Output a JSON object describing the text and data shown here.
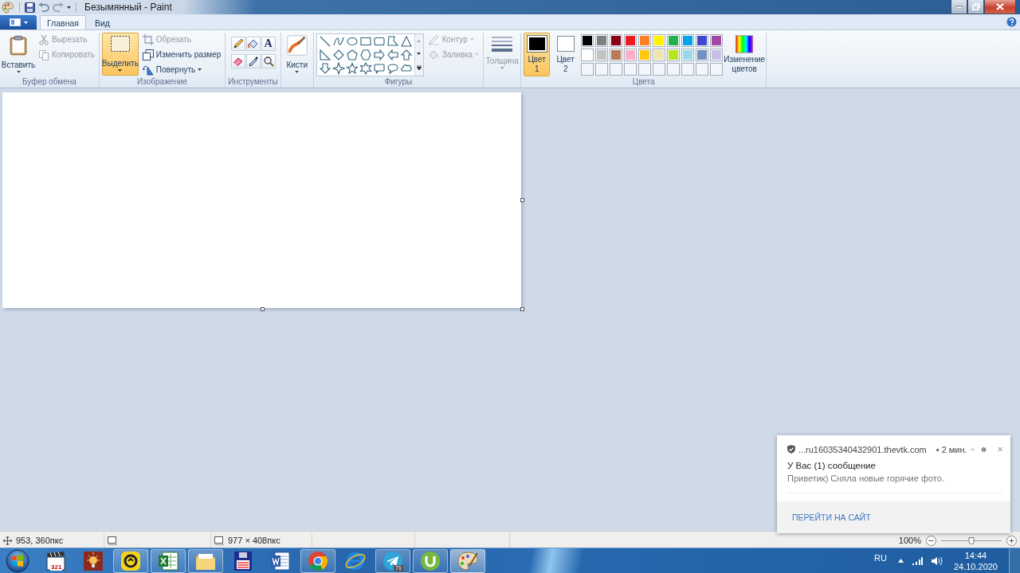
{
  "window": {
    "title": "Безымянный - Paint"
  },
  "tabs": [
    {
      "label": "Главная",
      "selected": true
    },
    {
      "label": "Вид",
      "selected": false
    }
  ],
  "clipboard": {
    "label": "Буфер обмена",
    "paste": "Вставить",
    "actions": [
      {
        "kind": "cut",
        "label": "Вырезать",
        "disabled": true
      },
      {
        "kind": "copy",
        "label": "Копировать",
        "disabled": true
      }
    ]
  },
  "image": {
    "label": "Изображение",
    "select": {
      "label": "Выделить",
      "selected": true
    },
    "actions": [
      {
        "kind": "crop",
        "label": "Обрезать",
        "disabled": true
      },
      {
        "kind": "resize",
        "label": "Изменить размер",
        "disabled": false
      },
      {
        "kind": "rotate",
        "label": "Повернуть",
        "disabled": false
      }
    ]
  },
  "tools": {
    "label": "Инструменты",
    "text_tool": "A"
  },
  "brushes": {
    "label": "Кисти"
  },
  "shapes": {
    "label": "Фигуры",
    "options": [
      {
        "kind": "outline",
        "label": "Контур",
        "disabled": true
      },
      {
        "kind": "fill",
        "label": "Заливка",
        "disabled": true
      }
    ]
  },
  "size": {
    "label": "Толщина",
    "disabled": true
  },
  "colors": {
    "label": "Цвета",
    "slots": [
      {
        "label": "Цвет",
        "number": "1",
        "selected": true,
        "color": "#000000"
      },
      {
        "label": "Цвет",
        "number": "2",
        "selected": false,
        "color": "#ffffff"
      }
    ],
    "palette": [
      {
        "color": "#000000"
      },
      {
        "color": "#7f7f7f"
      },
      {
        "color": "#880015"
      },
      {
        "color": "#ed1c24"
      },
      {
        "color": "#ff7f27"
      },
      {
        "color": "#fff200"
      },
      {
        "color": "#22b14c"
      },
      {
        "color": "#00a2e8"
      },
      {
        "color": "#3f48cc"
      },
      {
        "color": "#a349a4"
      },
      {
        "color": "#ffffff"
      },
      {
        "color": "#c3c3c3"
      },
      {
        "color": "#b97a57"
      },
      {
        "color": "#ffaec9"
      },
      {
        "color": "#ffc90e"
      },
      {
        "color": "#efe4b0"
      },
      {
        "color": "#b5e61d"
      },
      {
        "color": "#99d9ea"
      },
      {
        "color": "#7092be"
      },
      {
        "color": "#c8bfe7"
      }
    ],
    "edit": "Изменение цветов"
  },
  "status_bar": {
    "cursor": "953, 360пкс",
    "size": "977 × 408пкс",
    "zoom": "100%",
    "zoom_slider": {
      "level": 0.5
    }
  },
  "notification": {
    "source": "...ru16035340432901.thevtk.com",
    "time": "• 2 мин.",
    "title": "У Вас (1) сообщение",
    "body": "Приветик) Сняла новые горячие фото.",
    "action": "ПЕРЕЙТИ НА САЙТ"
  },
  "taskbar": {
    "apps": [
      {
        "kind": "media",
        "label": "321",
        "running": false,
        "selected": false
      },
      {
        "kind": "bulb",
        "running": false,
        "selected": false
      },
      {
        "kind": "lightshot",
        "running": true,
        "selected": false
      },
      {
        "kind": "sheet",
        "running": true,
        "selected": false
      },
      {
        "kind": "folder",
        "running": true,
        "selected": false
      },
      {
        "kind": "floppy",
        "running": false,
        "selected": false
      },
      {
        "kind": "document",
        "running": false,
        "selected": false
      },
      {
        "kind": "chrome",
        "running": true,
        "selected": false
      },
      {
        "kind": "ie",
        "running": false,
        "selected": false
      },
      {
        "kind": "telegram",
        "badge": "71",
        "running": true,
        "selected": false
      },
      {
        "kind": "torrent",
        "running": true,
        "selected": false
      },
      {
        "kind": "paint",
        "running": true,
        "selected": true
      }
    ],
    "language": "RU",
    "time": "14:44",
    "date": "24.10.2020"
  }
}
